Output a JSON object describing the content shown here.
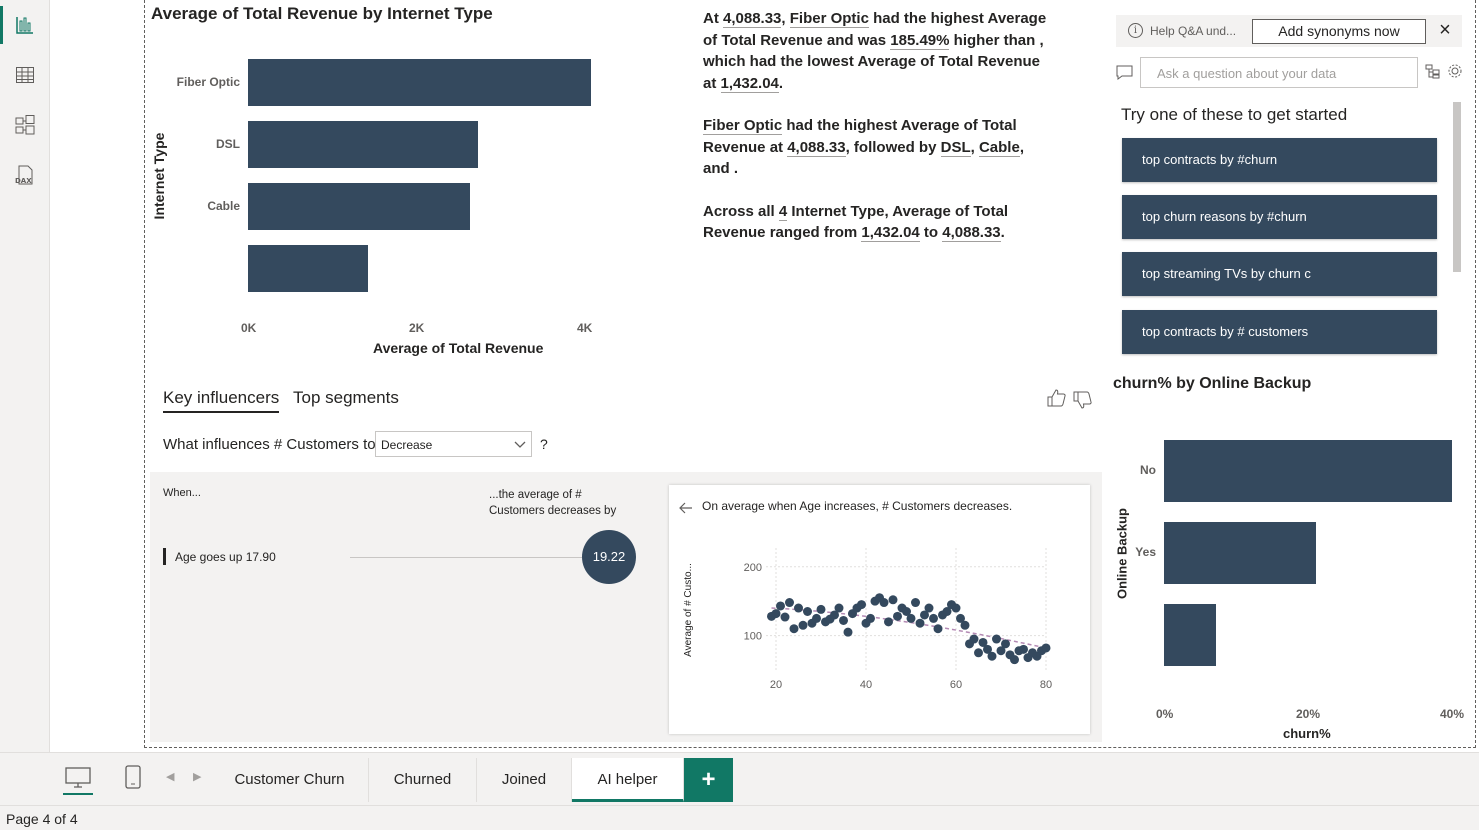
{
  "rail": {
    "icons": [
      "report-view-icon",
      "table-view-icon",
      "model-view-icon",
      "dax-query-icon"
    ]
  },
  "bar_chart": {
    "title": "Average of Total Revenue by Internet Type",
    "ylabel": "Internet Type",
    "xlabel": "Average of Total Revenue",
    "ticks": [
      "0K",
      "2K",
      "4K"
    ]
  },
  "churn_chart": {
    "title": "churn% by Online Backup",
    "ylabel": "Online Backup",
    "xlabel": "churn%",
    "ticks": [
      "0%",
      "20%",
      "40%"
    ]
  },
  "scatter": {
    "header": "On average when Age increases, # Customers decreases.",
    "ylabel": "Average of # Custo...",
    "yticks": [
      "200",
      "100"
    ],
    "xticks": [
      "20",
      "40",
      "60",
      "80"
    ]
  },
  "chart_data": [
    {
      "type": "bar",
      "title": "Average of Total Revenue by Internet Type",
      "ylabel": "Internet Type",
      "xlabel": "Average of Total Revenue",
      "categories": [
        "Fiber Optic",
        "DSL",
        "Cable",
        ""
      ],
      "values": [
        4088.33,
        2740,
        2650,
        1432.04
      ],
      "xlim": [
        0,
        4300
      ]
    },
    {
      "type": "bar",
      "title": "churn% by Online Backup",
      "ylabel": "Online Backup",
      "xlabel": "churn%",
      "categories": [
        "No",
        "Yes",
        ""
      ],
      "values": [
        40.8,
        21.6,
        7.3
      ],
      "xlim": [
        0,
        40.8
      ]
    },
    {
      "type": "scatter",
      "xlabel": "",
      "ylabel": "Average of # Custo...",
      "xlim": [
        20,
        80
      ],
      "ylim": [
        50,
        220
      ],
      "x": [
        19,
        20,
        21,
        22,
        23,
        24,
        25,
        26,
        27,
        28,
        29,
        30,
        31,
        32,
        33,
        34,
        35,
        36,
        37,
        38,
        39,
        40,
        41,
        42,
        43,
        44,
        45,
        46,
        47,
        48,
        49,
        50,
        51,
        52,
        53,
        54,
        55,
        56,
        57,
        58,
        59,
        60,
        61,
        62,
        63,
        64,
        65,
        66,
        67,
        68,
        69,
        70,
        71,
        72,
        73,
        74,
        75,
        76,
        77,
        78,
        79,
        80
      ],
      "y": [
        128,
        132,
        143,
        127,
        148,
        110,
        140,
        115,
        135,
        118,
        125,
        138,
        120,
        124,
        130,
        140,
        122,
        105,
        132,
        140,
        145,
        118,
        125,
        150,
        155,
        148,
        120,
        152,
        128,
        140,
        135,
        125,
        148,
        118,
        130,
        140,
        125,
        110,
        130,
        135,
        145,
        140,
        125,
        115,
        88,
        95,
        75,
        90,
        80,
        70,
        95,
        78,
        88,
        72,
        65,
        78,
        80,
        68,
        75,
        70,
        78,
        82
      ]
    }
  ],
  "narrative": {
    "p1": [
      "At ",
      "4,088.33",
      ", ",
      "Fiber Optic",
      " had the highest Average of Total Revenue and was ",
      "185.49%",
      " higher than , which had the lowest Average of Total Revenue at ",
      "1,432.04",
      "."
    ],
    "p2": [
      "Fiber Optic",
      " had the highest Average of Total Revenue at ",
      "4,088.33",
      ", followed by ",
      "DSL",
      ", ",
      "Cable",
      ", and ."
    ],
    "p3": [
      "Across all ",
      "4",
      " Internet Type, Average of Total Revenue ranged from ",
      "1,432.04",
      " to ",
      "4,088.33",
      "."
    ]
  },
  "qa": {
    "help_text": "Help Q&A und...",
    "synonyms_button": "Add synonyms now",
    "placeholder": "Ask a question about your data",
    "suggestions_title": "Try one of these to get started",
    "suggestions": [
      "top contracts by #churn",
      "top churn reasons by #churn",
      "top streaming TVs by churn c",
      "top contracts by # customers"
    ]
  },
  "key_influencers": {
    "tabs": [
      "Key influencers",
      "Top segments"
    ],
    "question": "What influences # Customers to",
    "selected": "Decrease",
    "qmark": "?",
    "when": "When...",
    "average_label": "...the average of # Customers decreases by",
    "influencer": "Age goes up 17.90",
    "value": "19.22"
  },
  "pages": [
    "Customer Churn",
    "Churned",
    "Joined",
    "AI helper"
  ],
  "active_page": "AI helper",
  "add_page": "+",
  "status": "Page 4 of 4",
  "colors": {
    "bar": "#34495e",
    "accent": "#117865",
    "trend": "#b48ab4"
  }
}
